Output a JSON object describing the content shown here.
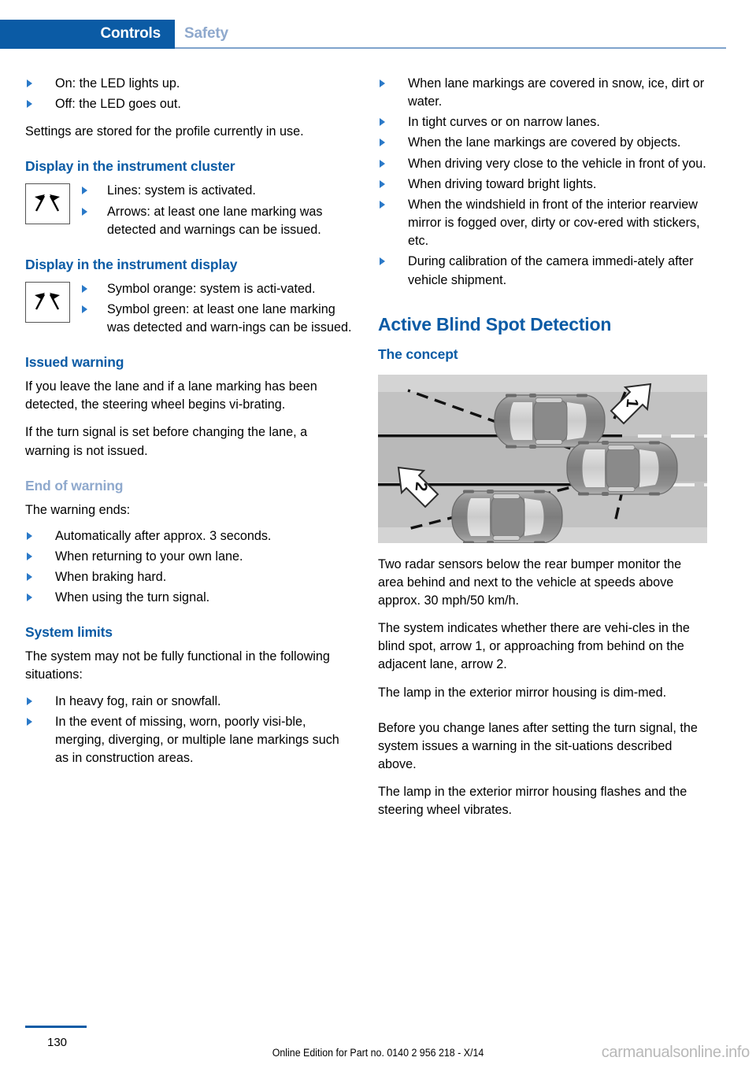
{
  "header": {
    "active_tab": "Controls",
    "inactive_tab": "Safety",
    "accent_color": "#0b5ba5",
    "muted_color": "#8fa9cd"
  },
  "left_column": {
    "top_bullets": [
      "On: the LED lights up.",
      "Off: the LED goes out."
    ],
    "settings_paragraph": "Settings are stored for the profile currently in use.",
    "cluster_heading": "Display in the instrument cluster",
    "cluster_bullets": [
      "Lines: system is activated.",
      "Arrows: at least one lane marking was detected and warnings can be issued."
    ],
    "display_heading": "Display in the instrument display",
    "display_bullets": [
      "Symbol orange: system is acti-vated.",
      "Symbol green: at least one lane marking was detected and warn-ings can be issued."
    ],
    "issued_warning_heading": "Issued warning",
    "issued_warning_p1": "If you leave the lane and if a lane marking has been detected, the steering wheel begins vi-brating.",
    "issued_warning_p2": "If the turn signal is set before changing the lane, a warning is not issued.",
    "end_of_warning_heading": "End of warning",
    "end_of_warning_intro": "The warning ends:",
    "end_of_warning_bullets": [
      "Automatically after approx. 3 seconds.",
      "When returning to your own lane.",
      "When braking hard.",
      "When using the turn signal."
    ],
    "system_limits_heading": "System limits",
    "system_limits_intro": "The system may not be fully functional in the following situations:",
    "system_limits_bullets": [
      "In heavy fog, rain or snowfall.",
      "In the event of missing, worn, poorly visi-ble, merging, diverging, or multiple lane markings such as in construction areas."
    ]
  },
  "right_column": {
    "limits_bullets_continued": [
      "When lane markings are covered in snow, ice, dirt or water.",
      "In tight curves or on narrow lanes.",
      "When the lane markings are covered by objects.",
      "When driving very close to the vehicle in front of you.",
      "When driving toward bright lights.",
      "When the windshield in front of the interior rearview mirror is fogged over, dirty or cov-ered with stickers, etc.",
      "During calibration of the camera immedi-ately after vehicle shipment."
    ],
    "section_heading": "Active Blind Spot Detection",
    "concept_heading": "The concept",
    "figure": {
      "alt": "Top-down illustration of a road with three cars; dashed radar detection zones behind and beside the center vehicle; callout arrow 1 points to the blind spot area, callout arrow 2 points to the adjacent lane behind.",
      "callout_1": "1",
      "callout_2": "2"
    },
    "paragraphs": [
      "Two radar sensors below the rear bumper monitor the area behind and next to the vehicle at speeds above approx. 30 mph/50 km/h.",
      "The system indicates whether there are vehi-cles in the blind spot, arrow 1, or approaching from behind on the adjacent lane, arrow 2.",
      "The lamp in the exterior mirror housing is dim-med.",
      "Before you change lanes after setting the turn signal, the system issues a warning in the sit-uations described above.",
      "The lamp in the exterior mirror housing flashes and the steering wheel vibrates."
    ]
  },
  "footer": {
    "page_number": "130",
    "edition_note": "Online Edition for Part no. 0140 2 956 218 - X/14",
    "watermark": "carmanualsonline.info"
  }
}
